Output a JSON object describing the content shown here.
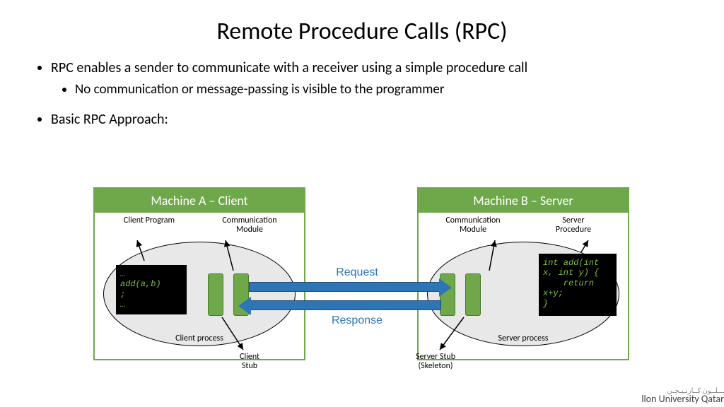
{
  "title": "Remote Procedure Calls (RPC)",
  "bullets": {
    "b1": "RPC enables a sender to communicate with a receiver using a simple procedure call",
    "b1a": "No communication or message-passing is visible to the programmer",
    "b2": "Basic RPC Approach:"
  },
  "machineA": {
    "header": "Machine A – Client",
    "label_left": "Client Program",
    "label_right": "Communication Module",
    "process": "Client process",
    "code": "…\nadd(a,b)\n;\n…"
  },
  "machineB": {
    "header": "Machine B – Server",
    "label_left": "Communication Module",
    "label_right": "Server Procedure",
    "process": "Server process",
    "code": "int add(int\nx, int y) {\n    return\nx+y;\n}"
  },
  "arrows": {
    "request": "Request",
    "response": "Response"
  },
  "stub_labels": {
    "client": "Client Stub",
    "server": "Server Stub (Skeleton)"
  },
  "logo": {
    "line1": "ـــلــون كــارنـيـجـي",
    "line2_a": "llon University",
    "line2_b": " Qatar"
  }
}
